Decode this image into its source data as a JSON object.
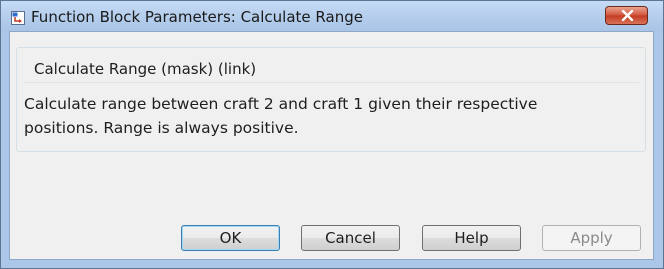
{
  "window": {
    "title": "Function Block Parameters: Calculate Range"
  },
  "group": {
    "legend": "Calculate Range (mask) (link)",
    "description_lines": [
      "Calculate range between craft 2 and craft 1 given their respective",
      "positions. Range is always positive."
    ]
  },
  "buttons": {
    "ok": "OK",
    "cancel": "Cancel",
    "help": "Help",
    "apply": "Apply"
  },
  "icons": {
    "app": "simulink-block-icon",
    "close": "close-icon"
  },
  "colors": {
    "titlebar": "#b4cdec",
    "close_button": "#c9442a",
    "client_background": "#f0f0f0",
    "disabled_text": "#8a8a8a"
  }
}
